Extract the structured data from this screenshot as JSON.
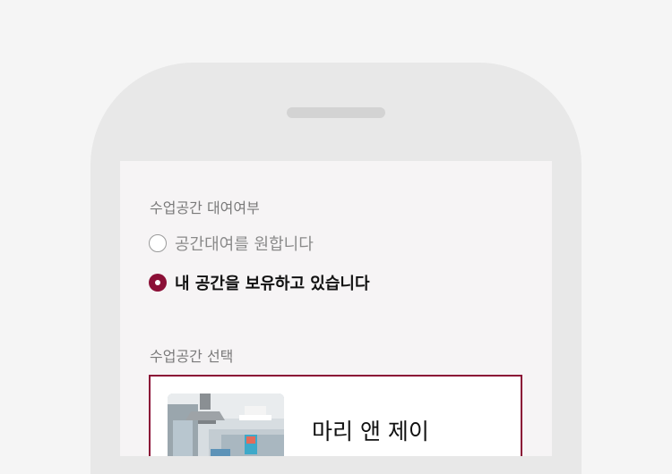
{
  "rental_section": {
    "label": "수업공간 대여여부",
    "options": [
      {
        "label": "공간대여를 원합니다",
        "selected": false
      },
      {
        "label": "내 공간을 보유하고 있습니다",
        "selected": true
      }
    ]
  },
  "space_section": {
    "label": "수업공간 선택",
    "card": {
      "name": "마리 앤 제이",
      "selected": true
    }
  },
  "colors": {
    "accent": "#8b0f36"
  }
}
